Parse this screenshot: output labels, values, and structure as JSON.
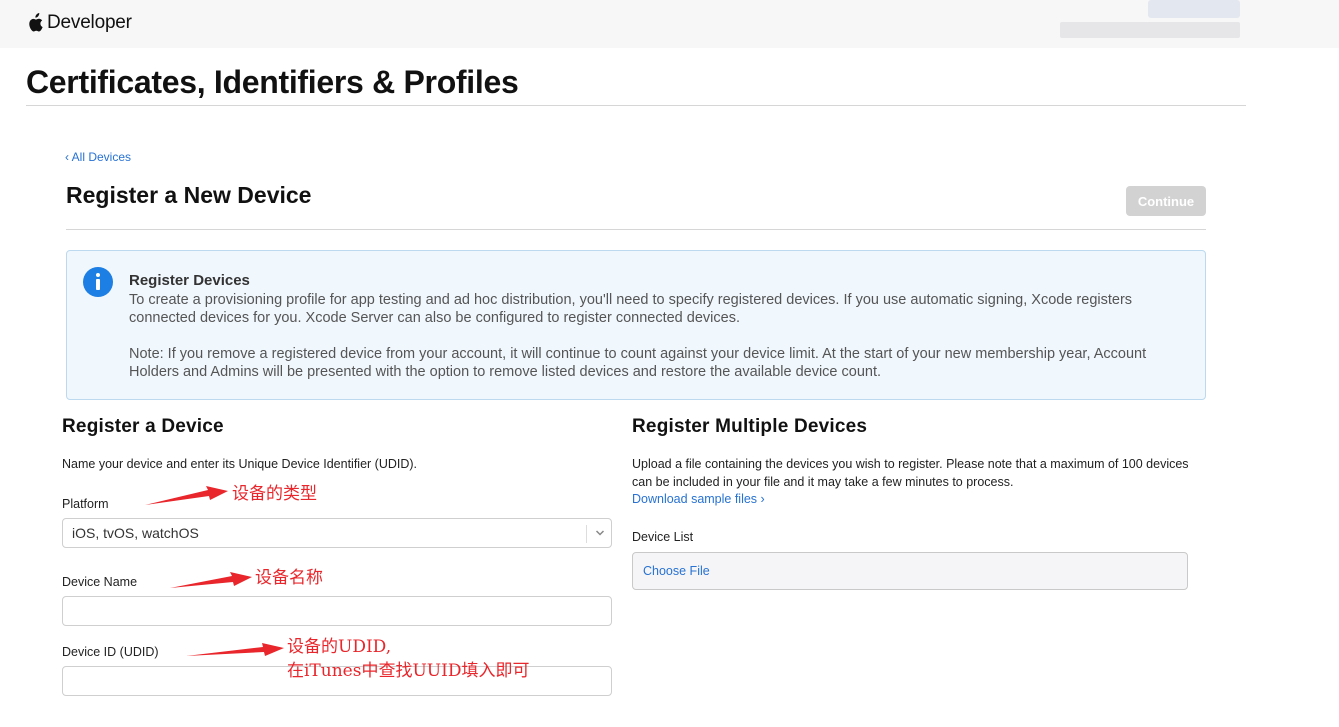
{
  "header": {
    "brand_text": "Developer",
    "brand_icon": "apple-logo-icon"
  },
  "page": {
    "title": "Certificates, Identifiers & Profiles",
    "back_link": "‹ All Devices",
    "section_title": "Register a New Device",
    "continue_label": "Continue"
  },
  "info_box": {
    "icon": "info-icon",
    "heading": "Register Devices",
    "paragraph1": "To create a provisioning profile for app testing and ad hoc distribution, you'll need to specify registered devices. If you use automatic signing, Xcode registers connected devices for you. Xcode Server can also be configured to register connected devices.",
    "paragraph2": "Note: If you remove a registered device from your account, it will continue to count against your device limit. At the start of your new membership year, Account Holders and Admins will be presented with the option to remove listed devices and restore the available device count."
  },
  "single": {
    "title": "Register a Device",
    "description": "Name your device and enter its Unique Device Identifier (UDID).",
    "platform_label": "Platform",
    "platform_value": "iOS, tvOS, watchOS",
    "device_name_label": "Device Name",
    "device_name_value": "",
    "udid_label": "Device ID (UDID)",
    "udid_value": ""
  },
  "multiple": {
    "title": "Register Multiple Devices",
    "description": "Upload a file containing the devices you wish to register. Please note that a maximum of 100 devices can be included in your file and it may take a few minutes to process.",
    "download_link": "Download sample files ›",
    "device_list_label": "Device List",
    "choose_file_label": "Choose File"
  },
  "annotations": {
    "platform_note": "设备的类型",
    "name_note": "设备名称",
    "udid_note_line1": "设备的UDID,",
    "udid_note_line2": "在iTunes中查找UUID填入即可"
  },
  "colors": {
    "link": "#2772d3",
    "annotation": "#e8262b",
    "info_icon": "#1d7ee3",
    "info_bg": "#f0f7fd",
    "button_disabled": "#d2d2d2"
  }
}
